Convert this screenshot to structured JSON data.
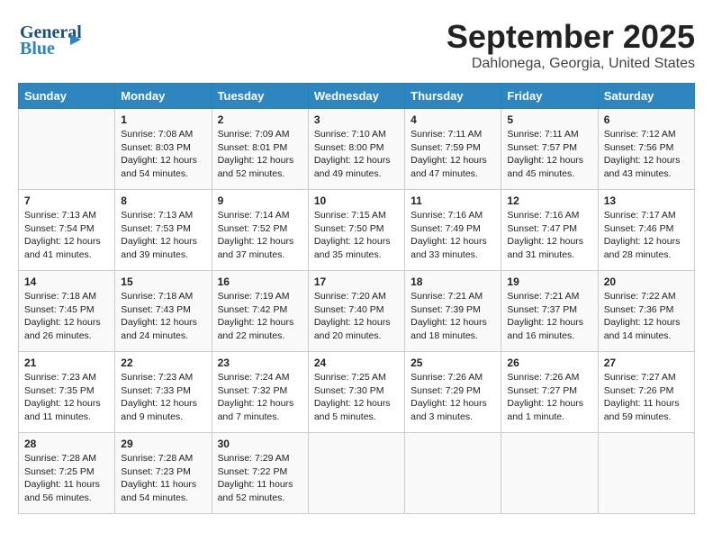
{
  "logo": {
    "line1": "General",
    "line2": "Blue"
  },
  "header": {
    "month_year": "September 2025",
    "location": "Dahlonega, Georgia, United States"
  },
  "weekdays": [
    "Sunday",
    "Monday",
    "Tuesday",
    "Wednesday",
    "Thursday",
    "Friday",
    "Saturday"
  ],
  "weeks": [
    [
      {
        "day": "",
        "content": ""
      },
      {
        "day": "1",
        "content": "Sunrise: 7:08 AM\nSunset: 8:03 PM\nDaylight: 12 hours\nand 54 minutes."
      },
      {
        "day": "2",
        "content": "Sunrise: 7:09 AM\nSunset: 8:01 PM\nDaylight: 12 hours\nand 52 minutes."
      },
      {
        "day": "3",
        "content": "Sunrise: 7:10 AM\nSunset: 8:00 PM\nDaylight: 12 hours\nand 49 minutes."
      },
      {
        "day": "4",
        "content": "Sunrise: 7:11 AM\nSunset: 7:59 PM\nDaylight: 12 hours\nand 47 minutes."
      },
      {
        "day": "5",
        "content": "Sunrise: 7:11 AM\nSunset: 7:57 PM\nDaylight: 12 hours\nand 45 minutes."
      },
      {
        "day": "6",
        "content": "Sunrise: 7:12 AM\nSunset: 7:56 PM\nDaylight: 12 hours\nand 43 minutes."
      }
    ],
    [
      {
        "day": "7",
        "content": "Sunrise: 7:13 AM\nSunset: 7:54 PM\nDaylight: 12 hours\nand 41 minutes."
      },
      {
        "day": "8",
        "content": "Sunrise: 7:13 AM\nSunset: 7:53 PM\nDaylight: 12 hours\nand 39 minutes."
      },
      {
        "day": "9",
        "content": "Sunrise: 7:14 AM\nSunset: 7:52 PM\nDaylight: 12 hours\nand 37 minutes."
      },
      {
        "day": "10",
        "content": "Sunrise: 7:15 AM\nSunset: 7:50 PM\nDaylight: 12 hours\nand 35 minutes."
      },
      {
        "day": "11",
        "content": "Sunrise: 7:16 AM\nSunset: 7:49 PM\nDaylight: 12 hours\nand 33 minutes."
      },
      {
        "day": "12",
        "content": "Sunrise: 7:16 AM\nSunset: 7:47 PM\nDaylight: 12 hours\nand 31 minutes."
      },
      {
        "day": "13",
        "content": "Sunrise: 7:17 AM\nSunset: 7:46 PM\nDaylight: 12 hours\nand 28 minutes."
      }
    ],
    [
      {
        "day": "14",
        "content": "Sunrise: 7:18 AM\nSunset: 7:45 PM\nDaylight: 12 hours\nand 26 minutes."
      },
      {
        "day": "15",
        "content": "Sunrise: 7:18 AM\nSunset: 7:43 PM\nDaylight: 12 hours\nand 24 minutes."
      },
      {
        "day": "16",
        "content": "Sunrise: 7:19 AM\nSunset: 7:42 PM\nDaylight: 12 hours\nand 22 minutes."
      },
      {
        "day": "17",
        "content": "Sunrise: 7:20 AM\nSunset: 7:40 PM\nDaylight: 12 hours\nand 20 minutes."
      },
      {
        "day": "18",
        "content": "Sunrise: 7:21 AM\nSunset: 7:39 PM\nDaylight: 12 hours\nand 18 minutes."
      },
      {
        "day": "19",
        "content": "Sunrise: 7:21 AM\nSunset: 7:37 PM\nDaylight: 12 hours\nand 16 minutes."
      },
      {
        "day": "20",
        "content": "Sunrise: 7:22 AM\nSunset: 7:36 PM\nDaylight: 12 hours\nand 14 minutes."
      }
    ],
    [
      {
        "day": "21",
        "content": "Sunrise: 7:23 AM\nSunset: 7:35 PM\nDaylight: 12 hours\nand 11 minutes."
      },
      {
        "day": "22",
        "content": "Sunrise: 7:23 AM\nSunset: 7:33 PM\nDaylight: 12 hours\nand 9 minutes."
      },
      {
        "day": "23",
        "content": "Sunrise: 7:24 AM\nSunset: 7:32 PM\nDaylight: 12 hours\nand 7 minutes."
      },
      {
        "day": "24",
        "content": "Sunrise: 7:25 AM\nSunset: 7:30 PM\nDaylight: 12 hours\nand 5 minutes."
      },
      {
        "day": "25",
        "content": "Sunrise: 7:26 AM\nSunset: 7:29 PM\nDaylight: 12 hours\nand 3 minutes."
      },
      {
        "day": "26",
        "content": "Sunrise: 7:26 AM\nSunset: 7:27 PM\nDaylight: 12 hours\nand 1 minute."
      },
      {
        "day": "27",
        "content": "Sunrise: 7:27 AM\nSunset: 7:26 PM\nDaylight: 11 hours\nand 59 minutes."
      }
    ],
    [
      {
        "day": "28",
        "content": "Sunrise: 7:28 AM\nSunset: 7:25 PM\nDaylight: 11 hours\nand 56 minutes."
      },
      {
        "day": "29",
        "content": "Sunrise: 7:28 AM\nSunset: 7:23 PM\nDaylight: 11 hours\nand 54 minutes."
      },
      {
        "day": "30",
        "content": "Sunrise: 7:29 AM\nSunset: 7:22 PM\nDaylight: 11 hours\nand 52 minutes."
      },
      {
        "day": "",
        "content": ""
      },
      {
        "day": "",
        "content": ""
      },
      {
        "day": "",
        "content": ""
      },
      {
        "day": "",
        "content": ""
      }
    ]
  ]
}
